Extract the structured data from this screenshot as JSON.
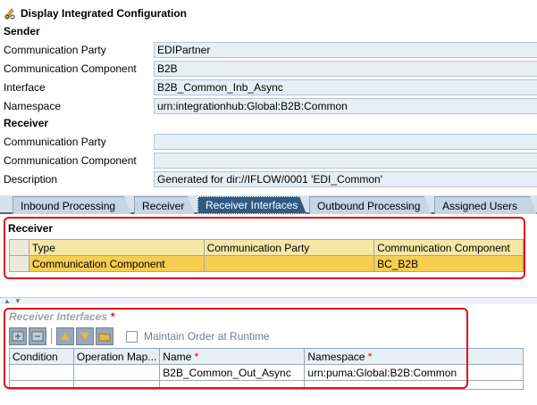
{
  "header": {
    "title": "Display Integrated Configuration"
  },
  "sender": {
    "heading": "Sender",
    "fields": [
      {
        "label": "Communication Party",
        "value": "EDIPartner"
      },
      {
        "label": "Communication Component",
        "value": "B2B"
      },
      {
        "label": "Interface",
        "value": "B2B_Common_Inb_Async"
      },
      {
        "label": "Namespace",
        "value": "urn:integrationhub:Global:B2B:Common"
      }
    ]
  },
  "receiver_section": {
    "heading": "Receiver",
    "fields": [
      {
        "label": "Communication Party",
        "value": ""
      },
      {
        "label": "Communication Component",
        "value": ""
      },
      {
        "label": "Description",
        "value": "Generated for dir://IFLOW/0001 'EDI_Common'"
      }
    ]
  },
  "tabs": [
    {
      "label": "Inbound Processing",
      "active": false
    },
    {
      "label": "Receiver",
      "active": false
    },
    {
      "label": "Receiver Interfaces",
      "active": true
    },
    {
      "label": "Outbound Processing",
      "active": false
    },
    {
      "label": "Assigned Users",
      "active": false
    }
  ],
  "receiver_table": {
    "heading": "Receiver",
    "columns": [
      "Type",
      "Communication Party",
      "Communication Component"
    ],
    "rows": [
      [
        "Communication Component",
        "",
        "BC_B2B"
      ]
    ]
  },
  "receiver_interfaces": {
    "heading": "Receiver Interfaces",
    "required_mark": "*",
    "maintain_order_label": "Maintain Order at Runtime",
    "columns": [
      "Condition",
      "Operation Map...",
      "Name",
      "Namespace"
    ],
    "rows": [
      [
        "",
        "",
        "B2B_Common_Out_Async",
        "urn:puma:Global:B2B:Common"
      ]
    ]
  },
  "colors": {
    "selected_row": "#f7ce4f",
    "active_tab": "#2f5a82",
    "highlight_box": "#e01010"
  }
}
